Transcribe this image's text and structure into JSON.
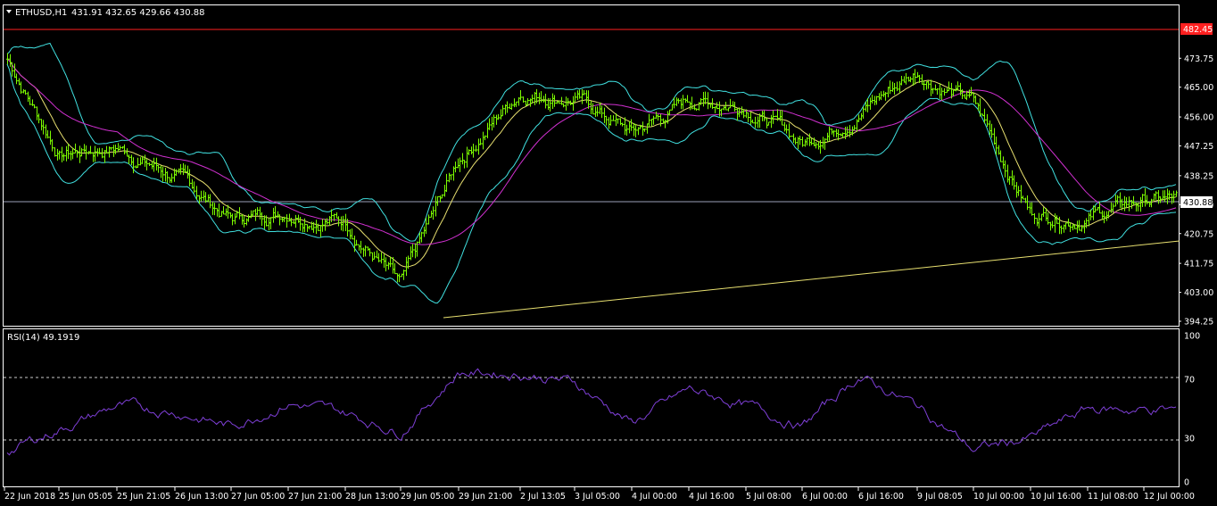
{
  "header": {
    "symbol_label": "ETHUSD,H1",
    "ohlc": "431.91 432.65 429.66 430.88"
  },
  "rsi": {
    "label": "RSI(14) 49.1919",
    "levels": [
      70,
      30
    ],
    "ticks": [
      "100",
      "70",
      "30",
      "0"
    ],
    "color": "#7e3fd6"
  },
  "price_axis": {
    "ticks": [
      "473.75",
      "465.00",
      "456.00",
      "447.25",
      "438.25",
      "429.50",
      "420.75",
      "411.75",
      "403.00",
      "394.25"
    ],
    "current_price": "430.88",
    "red_level": "482.45"
  },
  "time_axis": {
    "labels": [
      "22 Jun 2018",
      "25 Jun 05:05",
      "25 Jun 21:05",
      "26 Jun 13:00",
      "27 Jun 05:00",
      "27 Jun 21:00",
      "28 Jun 13:00",
      "29 Jun 05:00",
      "29 Jun 21:00",
      "2 Jul 13:05",
      "3 Jul 05:00",
      "4 Jul 00:00",
      "4 Jul 16:00",
      "5 Jul 08:00",
      "6 Jul 00:00",
      "6 Jul 16:00",
      "9 Jul 08:05",
      "10 Jul 00:00",
      "10 Jul 16:00",
      "11 Jul 08:00",
      "12 Jul 00:00"
    ]
  },
  "colors": {
    "candles": "#7cfc00",
    "bollinger": "#40e0e0",
    "ma_fast": "#e8e070",
    "ma_slow": "#d030d0",
    "trendline": "#e8e070",
    "red_line": "#ff2020",
    "grid_frame": "#ffffff"
  },
  "chart_data": {
    "type": "line",
    "title": "ETHUSD,H1",
    "series_note": "approximate close path of H1 candles",
    "ylim": [
      394.25,
      482.45
    ],
    "keyframes": [
      {
        "x": "22 Jun 2018",
        "close": 475
      },
      {
        "x": "25 Jun 05:05",
        "close": 445
      },
      {
        "x": "25 Jun 21:05",
        "close": 447
      },
      {
        "x": "26 Jun 13:00",
        "close": 438
      },
      {
        "x": "27 Jun 05:00",
        "close": 425
      },
      {
        "x": "27 Jun 21:00",
        "close": 428
      },
      {
        "x": "28 Jun 13:00",
        "close": 425
      },
      {
        "x": "29 Jun 05:00",
        "close": 404
      },
      {
        "x": "29 Jun 21:00",
        "close": 443
      },
      {
        "x": "2 Jul 13:05",
        "close": 464
      },
      {
        "x": "3 Jul 05:00",
        "close": 462
      },
      {
        "x": "4 Jul 00:00",
        "close": 451
      },
      {
        "x": "4 Jul 16:00",
        "close": 461
      },
      {
        "x": "5 Jul 08:00",
        "close": 460
      },
      {
        "x": "6 Jul 00:00",
        "close": 448
      },
      {
        "x": "6 Jul 16:00",
        "close": 458
      },
      {
        "x": "9 Jul 08:05",
        "close": 470
      },
      {
        "x": "10 Jul 00:00",
        "close": 460
      },
      {
        "x": "10 Jul 16:00",
        "close": 427
      },
      {
        "x": "11 Jul 08:00",
        "close": 426
      },
      {
        "x": "12 Jul 00:00",
        "close": 430.88
      }
    ],
    "rsi_keyframes": [
      20,
      36,
      52,
      48,
      38,
      54,
      47,
      34,
      75,
      74,
      68,
      40,
      63,
      52,
      38,
      72,
      52,
      22,
      30,
      50,
      49.19
    ]
  }
}
